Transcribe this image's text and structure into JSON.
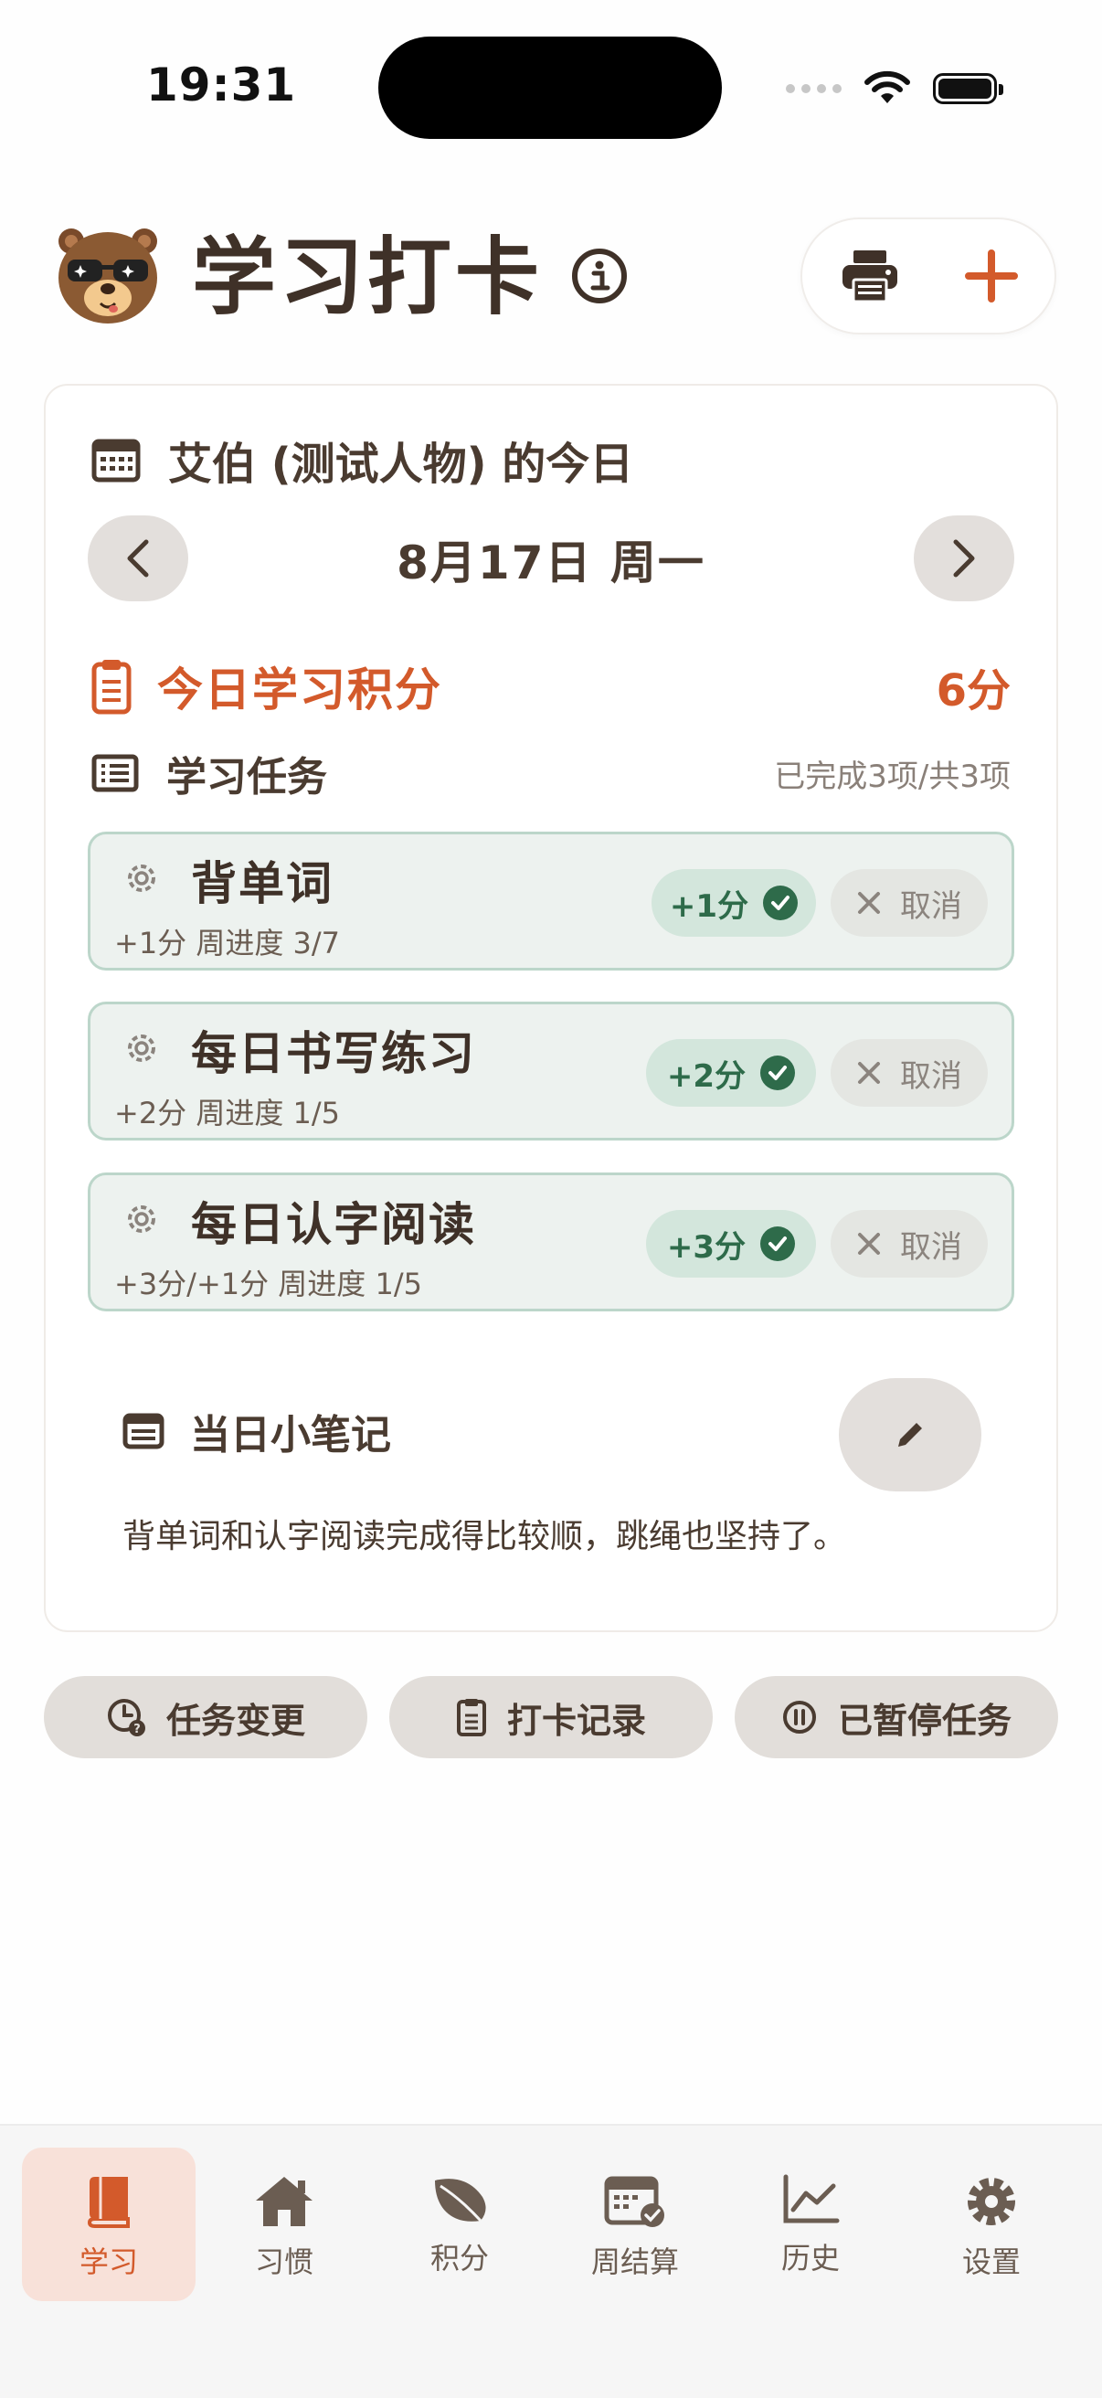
{
  "status_bar": {
    "time": "19:31"
  },
  "header": {
    "title": "学习打卡"
  },
  "card": {
    "heading": "艾伯 (测试人物) 的今日",
    "date": "8月17日 周一",
    "score_label": "今日学习积分",
    "score_value": "6分",
    "tasks_title": "学习任务",
    "tasks_summary": "已完成3项/共3项"
  },
  "tasks": [
    {
      "name": "背单词",
      "meta": "+1分  周进度 3/7",
      "points": "+1分",
      "cancel": "取消"
    },
    {
      "name": "每日书写练习",
      "meta": "+2分  周进度 1/5",
      "points": "+2分",
      "cancel": "取消"
    },
    {
      "name": "每日认字阅读",
      "meta": "+3分/+1分  周进度 1/5",
      "points": "+3分",
      "cancel": "取消"
    }
  ],
  "notes": {
    "title": "当日小笔记",
    "text": "背单词和认字阅读完成得比较顺，跳绳也坚持了。"
  },
  "actions": [
    {
      "label": "任务变更",
      "icon": "clock-question-icon"
    },
    {
      "label": "打卡记录",
      "icon": "clipboard-icon"
    },
    {
      "label": "已暂停任务",
      "icon": "pause-circle-icon"
    }
  ],
  "tabs": [
    {
      "label": "学习",
      "icon": "book-icon",
      "active": true
    },
    {
      "label": "习惯",
      "icon": "home-icon",
      "active": false
    },
    {
      "label": "积分",
      "icon": "leaf-icon",
      "active": false
    },
    {
      "label": "周结算",
      "icon": "calendar-check-icon",
      "active": false
    },
    {
      "label": "历史",
      "icon": "line-chart-icon",
      "active": false
    },
    {
      "label": "设置",
      "icon": "gear-icon",
      "active": false
    }
  ],
  "colors": {
    "accent": "#D35A2B",
    "text": "#4A3B30",
    "done_green": "#2E6B4A",
    "task_bg": "#EDF2EF",
    "task_border": "#BCD6CA"
  }
}
